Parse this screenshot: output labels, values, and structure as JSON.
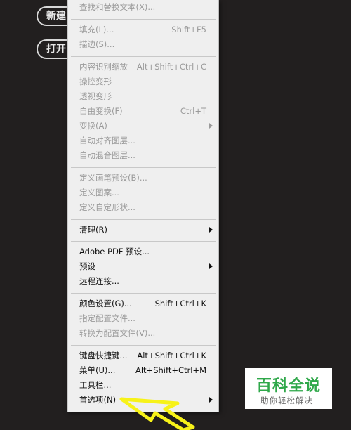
{
  "background_buttons": {
    "new": "新建",
    "open": "打开"
  },
  "menu": {
    "groups": [
      [
        {
          "label": "查找和替换文本(X)...",
          "shortcut": "",
          "enabled": false,
          "submenu": false
        }
      ],
      [
        {
          "label": "填充(L)...",
          "shortcut": "Shift+F5",
          "enabled": false,
          "submenu": false
        },
        {
          "label": "描边(S)...",
          "shortcut": "",
          "enabled": false,
          "submenu": false
        }
      ],
      [
        {
          "label": "内容识别缩放",
          "shortcut": "Alt+Shift+Ctrl+C",
          "enabled": false,
          "submenu": false
        },
        {
          "label": "操控变形",
          "shortcut": "",
          "enabled": false,
          "submenu": false
        },
        {
          "label": "透视变形",
          "shortcut": "",
          "enabled": false,
          "submenu": false
        },
        {
          "label": "自由变换(F)",
          "shortcut": "Ctrl+T",
          "enabled": false,
          "submenu": false
        },
        {
          "label": "变换(A)",
          "shortcut": "",
          "enabled": false,
          "submenu": true
        },
        {
          "label": "自动对齐图层...",
          "shortcut": "",
          "enabled": false,
          "submenu": false
        },
        {
          "label": "自动混合图层...",
          "shortcut": "",
          "enabled": false,
          "submenu": false
        }
      ],
      [
        {
          "label": "定义画笔预设(B)...",
          "shortcut": "",
          "enabled": false,
          "submenu": false
        },
        {
          "label": "定义图案...",
          "shortcut": "",
          "enabled": false,
          "submenu": false
        },
        {
          "label": "定义自定形状...",
          "shortcut": "",
          "enabled": false,
          "submenu": false
        }
      ],
      [
        {
          "label": "清理(R)",
          "shortcut": "",
          "enabled": true,
          "submenu": true
        }
      ],
      [
        {
          "label": "Adobe PDF 预设...",
          "shortcut": "",
          "enabled": true,
          "submenu": false
        },
        {
          "label": "预设",
          "shortcut": "",
          "enabled": true,
          "submenu": true
        },
        {
          "label": "远程连接...",
          "shortcut": "",
          "enabled": true,
          "submenu": false
        }
      ],
      [
        {
          "label": "颜色设置(G)...",
          "shortcut": "Shift+Ctrl+K",
          "enabled": true,
          "submenu": false
        },
        {
          "label": "指定配置文件...",
          "shortcut": "",
          "enabled": false,
          "submenu": false
        },
        {
          "label": "转换为配置文件(V)...",
          "shortcut": "",
          "enabled": false,
          "submenu": false
        }
      ],
      [
        {
          "label": "键盘快捷键...",
          "shortcut": "Alt+Shift+Ctrl+K",
          "enabled": true,
          "submenu": false
        },
        {
          "label": "菜单(U)...",
          "shortcut": "Alt+Shift+Ctrl+M",
          "enabled": true,
          "submenu": false
        },
        {
          "label": "工具栏...",
          "shortcut": "",
          "enabled": true,
          "submenu": false
        },
        {
          "label": "首选项(N)",
          "shortcut": "",
          "enabled": true,
          "submenu": true
        }
      ]
    ]
  },
  "watermark": {
    "title": "百科全说",
    "subtitle": "助你轻松解决"
  },
  "colors": {
    "menu_bg": "#efefef",
    "disabled_text": "#9a9a9a",
    "highlight_arrow": "#f7f219",
    "watermark_green": "#2fa84a"
  }
}
